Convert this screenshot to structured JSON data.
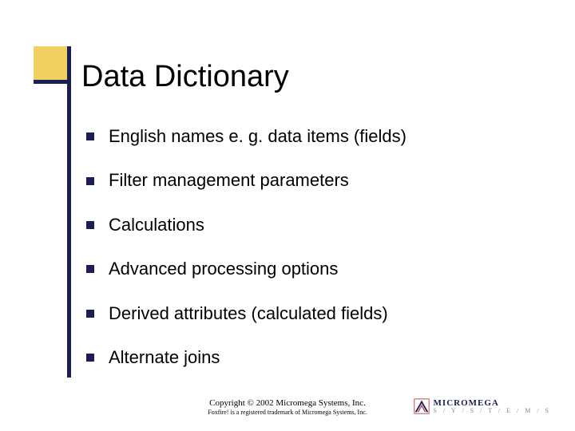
{
  "title": "Data Dictionary",
  "bullets": [
    "English names e. g. data items (fields)",
    "Filter management parameters",
    "Calculations",
    "Advanced processing options",
    "Derived attributes (calculated fields)",
    "Alternate joins"
  ],
  "footer": {
    "copyright": "Copyright © 2002 Micromega Systems, Inc.",
    "trademark": "Foxfire! is a registered trademark of Micromega Systems, Inc."
  },
  "logo": {
    "name": "MICROMEGA",
    "sub": "S / Y / S / T / E / M / S"
  }
}
